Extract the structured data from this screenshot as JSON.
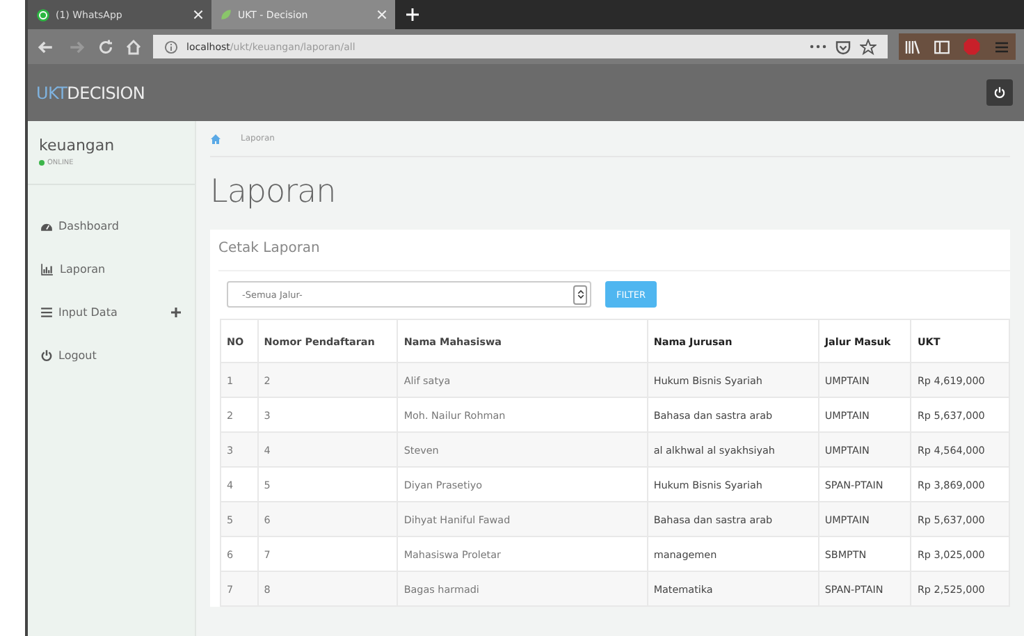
{
  "browser": {
    "tabs": [
      {
        "title": "(1) WhatsApp",
        "selected": false
      },
      {
        "title": "UKT - Decision",
        "selected": true
      }
    ],
    "url": {
      "host": "localhost",
      "path": "/ukt/keuangan/laporan/all"
    }
  },
  "app": {
    "brand": {
      "accent": "UKT",
      "rest": "DECISION"
    }
  },
  "user": {
    "name": "keuangan",
    "status": "ONLINE"
  },
  "sidebar": {
    "items": [
      {
        "label": "Dashboard",
        "expandable": false
      },
      {
        "label": "Laporan",
        "expandable": false
      },
      {
        "label": "Input Data",
        "expandable": true
      },
      {
        "label": "Logout",
        "expandable": false
      }
    ]
  },
  "breadcrumb": [
    "Laporan"
  ],
  "page_title": "Laporan",
  "panel": {
    "title": "Cetak Laporan",
    "filter": {
      "value": "-Semua Jalur-",
      "button": "FILTER"
    }
  },
  "table": {
    "columns": [
      "NO",
      "Nomor Pendaftaran",
      "Nama Mahasiswa",
      "Nama Jurusan",
      "Jalur Masuk",
      "UKT"
    ],
    "rows": [
      [
        "1",
        "2",
        "Alif satya",
        "Hukum Bisnis Syariah",
        "UMPTAIN",
        "Rp 4,619,000"
      ],
      [
        "2",
        "3",
        "Moh. Nailur Rohman",
        "Bahasa dan sastra arab",
        "UMPTAIN",
        "Rp 5,637,000"
      ],
      [
        "3",
        "4",
        "Steven",
        "al alkhwal al syakhsiyah",
        "UMPTAIN",
        "Rp 4,564,000"
      ],
      [
        "4",
        "5",
        "Diyan Prasetiyo",
        "Hukum Bisnis Syariah",
        "SPAN-PTAIN",
        "Rp 3,869,000"
      ],
      [
        "5",
        "6",
        "Dihyat Haniful Fawad",
        "Bahasa dan sastra arab",
        "UMPTAIN",
        "Rp 5,637,000"
      ],
      [
        "6",
        "7",
        "Mahasiswa Proletar",
        "managemen",
        "SBMPTN",
        "Rp 3,025,000"
      ],
      [
        "7",
        "8",
        "Bagas harmadi",
        "Matematika",
        "SPAN-PTAIN",
        "Rp 2,525,000"
      ]
    ]
  }
}
